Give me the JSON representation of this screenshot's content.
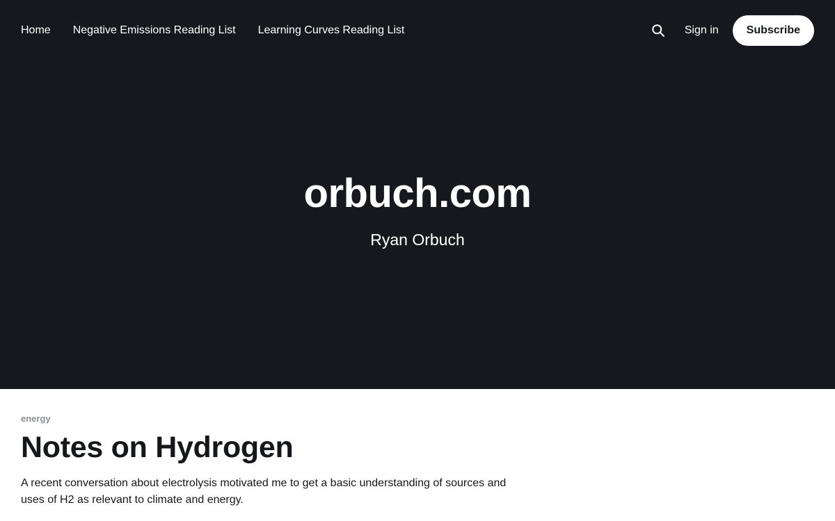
{
  "nav": {
    "links": [
      {
        "label": "Home"
      },
      {
        "label": "Negative Emissions Reading List"
      },
      {
        "label": "Learning Curves Reading List"
      }
    ],
    "signin_label": "Sign in",
    "subscribe_label": "Subscribe",
    "search_icon": "search-icon"
  },
  "hero": {
    "title": "orbuch.com",
    "subtitle": "Ryan Orbuch"
  },
  "post": {
    "tag": "energy",
    "title": "Notes on Hydrogen",
    "excerpt": "A recent conversation about electrolysis motivated me to get a basic understanding of sources and uses of H2 as relevant to climate and energy."
  },
  "colors": {
    "hero_background": "#17181d",
    "text_dark": "#15171a",
    "tag_gray": "#8a8d92"
  }
}
